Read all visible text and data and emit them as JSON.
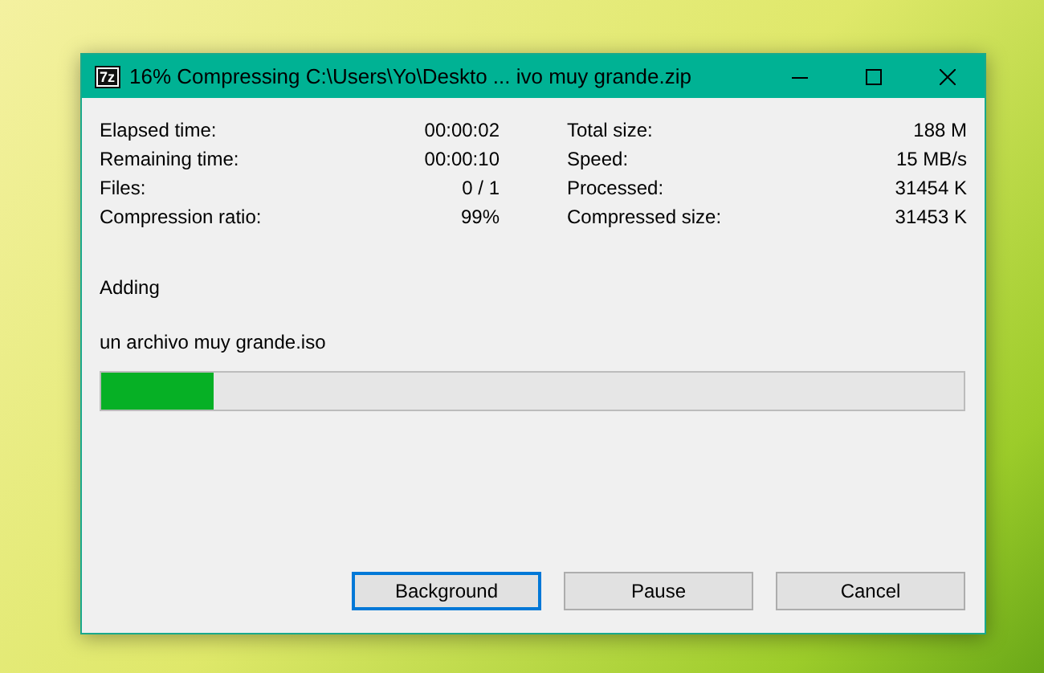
{
  "window": {
    "title": "16% Compressing C:\\Users\\Yo\\Deskto ... ivo muy grande.zip",
    "logo": "7z"
  },
  "stats_left": [
    {
      "label": "Elapsed time:",
      "value": "00:00:02"
    },
    {
      "label": "Remaining time:",
      "value": "00:00:10"
    },
    {
      "label": "Files:",
      "value": "0 / 1"
    },
    {
      "label": "Compression ratio:",
      "value": "99%"
    }
  ],
  "stats_right": [
    {
      "label": "Total size:",
      "value": "188 M"
    },
    {
      "label": "Speed:",
      "value": "15 MB/s"
    },
    {
      "label": "Processed:",
      "value": "31454 K"
    },
    {
      "label": "Compressed size:",
      "value": "31453 K"
    }
  ],
  "operation": "Adding",
  "current_file": "un archivo muy grande.iso",
  "progress": {
    "level": 0.13
  },
  "buttons": [
    {
      "label": "Background",
      "focused": true
    },
    {
      "label": "Pause",
      "focused": false
    },
    {
      "label": "Cancel",
      "focused": false
    }
  ]
}
